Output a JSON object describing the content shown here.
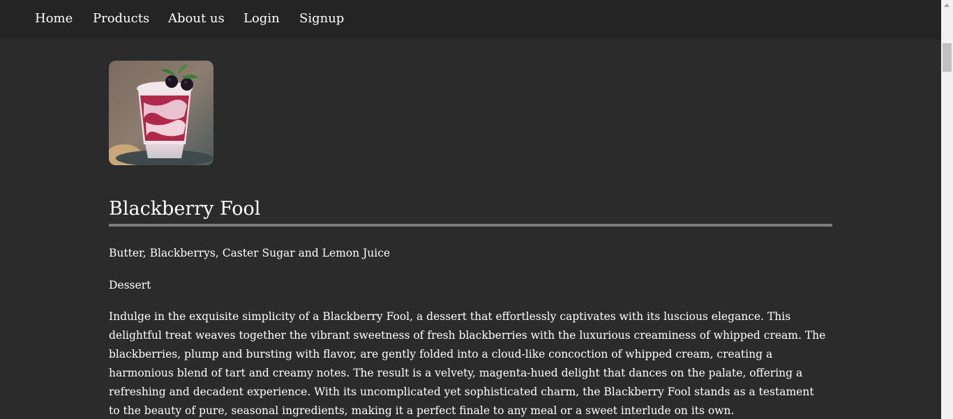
{
  "nav": {
    "items": [
      {
        "label": "Home"
      },
      {
        "label": "Products"
      },
      {
        "label": "About us"
      },
      {
        "label": "Login"
      },
      {
        "label": "Signup"
      }
    ]
  },
  "product": {
    "image_icon": "dessert-photo",
    "title": "Blackberry Fool",
    "ingredients": "Butter, Blackberrys, Caster Sugar and Lemon Juice",
    "category": "Dessert",
    "description": "Indulge in the exquisite simplicity of a Blackberry Fool, a dessert that effortlessly captivates with its luscious elegance. This delightful treat weaves together the vibrant sweetness of fresh blackberries with the luxurious creaminess of whipped cream. The blackberries, plump and bursting with flavor, are gently folded into a cloud-like concoction of whipped cream, creating a harmonious blend of tart and creamy notes. The result is a velvety, magenta-hued delight that dances on the palate, offering a refreshing and decadent experience. With its uncomplicated yet sophisticated charm, the Blackberry Fool stands as a testament to the beauty of pure, seasonal ingredients, making it a perfect finale to any meal or a sweet interlude on its own."
  },
  "colors": {
    "background": "#2b2b2b",
    "navbar": "#242424",
    "text": "#ffffff",
    "rule": "#7d7d7d"
  }
}
